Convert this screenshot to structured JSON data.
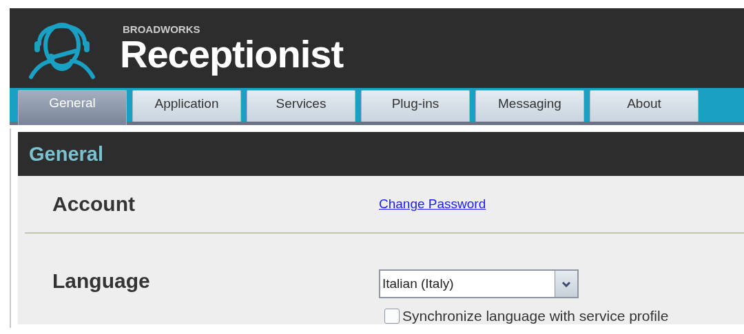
{
  "header": {
    "brand_small": "BROADWORKS",
    "brand_large": "Receptionist"
  },
  "tabs": [
    {
      "label": "General",
      "selected": true
    },
    {
      "label": "Application",
      "selected": false
    },
    {
      "label": "Services",
      "selected": false
    },
    {
      "label": "Plug-ins",
      "selected": false
    },
    {
      "label": "Messaging",
      "selected": false
    },
    {
      "label": "About",
      "selected": false
    }
  ],
  "panel_title": "General",
  "sections": [
    {
      "kind": "link",
      "heading": "Account",
      "link": "Change Password"
    },
    {
      "kind": "select",
      "heading": "Language",
      "value": "Italian (Italy)",
      "checkbox": {
        "label": "Synchronize language with service profile",
        "checked": false
      }
    }
  ]
}
